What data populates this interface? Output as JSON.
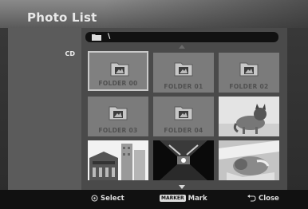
{
  "window": {
    "title": "Photo List"
  },
  "sidebar": {
    "items": [
      {
        "label": "CD"
      }
    ]
  },
  "path": {
    "text": "\\",
    "icon": "folder-icon"
  },
  "grid": {
    "folders": [
      {
        "label": "FOLDER 00",
        "selected": true
      },
      {
        "label": "FOLDER 01"
      },
      {
        "label": "FOLDER 02"
      },
      {
        "label": "FOLDER 03"
      },
      {
        "label": "FOLDER 04"
      }
    ],
    "photos": [
      {
        "subject": "cat"
      },
      {
        "subject": "building"
      },
      {
        "subject": "tunnel"
      },
      {
        "subject": "sleeping-cat"
      }
    ]
  },
  "footer": {
    "select": {
      "icon": "circle-select-icon",
      "label": "Select"
    },
    "mark": {
      "badge": "MARKER",
      "label": "Mark"
    },
    "close": {
      "icon": "return-icon",
      "label": "Close"
    }
  },
  "colors": {
    "selection_border": "#c9c9c9",
    "tile": "#7b7b7b",
    "panel": "#4a4a4a"
  }
}
